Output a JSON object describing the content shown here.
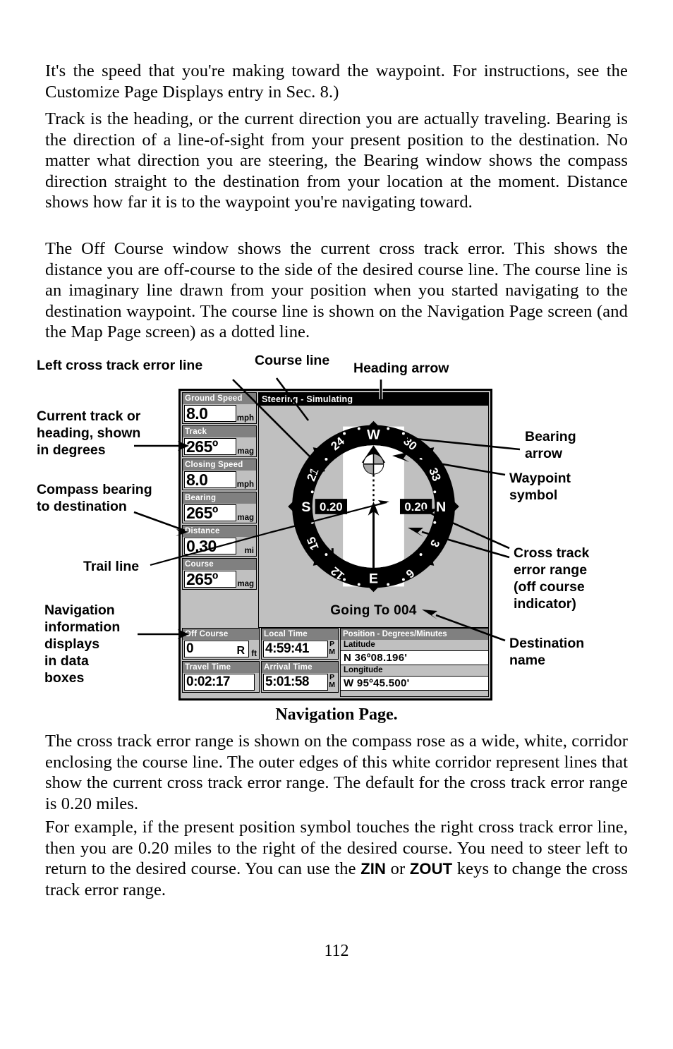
{
  "body_text": {
    "p1": "It's the speed that you're making toward the waypoint. For instructions, see the Customize Page Displays entry in Sec. 8.)",
    "p2": "Track is the heading, or the current direction you are actually traveling. Bearing is the direction of a line-of-sight from your present position to the destination. No matter what direction you are steering, the Bearing window shows the compass direction straight to the destination from your location at the moment. Distance shows how far it is to the waypoint you're navigating toward.",
    "p3": "The Off Course window shows the current cross track error. This shows the distance you are off-course to the side of the desired course line. The course line is an imaginary line drawn from your position when you started navigating to the destination waypoint. The course line is shown on the Navigation Page screen (and the Map Page screen) as a dotted line.",
    "p4": "The cross track error range is shown on the compass rose as a wide, white, corridor enclosing the course line. The outer edges of this white corridor represent lines that show the current cross track error range. The default for the cross track error range is 0.20 miles.",
    "p5_a": "For example, if the present position symbol touches the right cross track error line, then you are 0.20 miles to the right of the desired course. You need to steer left to return to the desired course. You can use the ",
    "p5_key1": "ZIN",
    "p5_b": " or ",
    "p5_key2": "ZOUT",
    "p5_c": " keys to change the cross track error range."
  },
  "figure": {
    "caption": "Navigation Page.",
    "annotations": {
      "left_cross_track_error_line": "Left cross track error line",
      "course_line": "Course line",
      "heading_arrow": "Heading arrow",
      "current_track": "Current track or\nheading, shown\nin degrees",
      "compass_bearing": "Compass bearing\nto destination",
      "trail_line": "Trail line",
      "nav_info_displays": "Navigation\ninformation\ndisplays\nin data\nboxes",
      "bearing_arrow": "Bearing\narrow",
      "waypoint_symbol": "Waypoint\nsymbol",
      "cross_track_error_range": "Cross track\nerror range\n(off course\nindicator)",
      "destination_name": "Destination\nname"
    }
  },
  "gps": {
    "status_bar": "Steering - Simulating",
    "going_to": "Going To 004",
    "left_boxes": [
      {
        "label": "Ground Speed",
        "value": "8.0",
        "unit": "mph"
      },
      {
        "label": "Track",
        "value": "265º",
        "unit": "mag"
      },
      {
        "label": "Closing Speed",
        "value": "8.0",
        "unit": "mph"
      },
      {
        "label": "Bearing",
        "value": "265º",
        "unit": "mag"
      },
      {
        "label": "Distance",
        "value": "0.30",
        "unit": "mi"
      },
      {
        "label": "Course",
        "value": "265º",
        "unit": "mag"
      }
    ],
    "bottom_boxes": [
      {
        "label": "Off Course",
        "value": "0",
        "side": "R",
        "unit": "ft"
      },
      {
        "label": "Travel Time",
        "value": "0:02:17",
        "unit": ""
      },
      {
        "label": "Local Time",
        "value": "4:59:41",
        "ampm": "P\nM"
      },
      {
        "label": "Arrival Time",
        "value": "5:01:58",
        "ampm": "P\nM"
      }
    ],
    "position": {
      "header": "Position - Degrees/Minutes",
      "lat_label": "Latitude",
      "lat_value": "N   36º08.196'",
      "lon_label": "Longitude",
      "lon_value": "W   95º45.500'"
    },
    "compass": {
      "cardinals": {
        "top": "W",
        "right": "N",
        "bottom": "E",
        "left": "S"
      },
      "ticks": [
        "24",
        "30",
        "33",
        "3",
        "6",
        "12",
        "15",
        "21"
      ],
      "xte_left": "0.20",
      "xte_right": "0.20"
    },
    "colors": {
      "screen_bg": "#c0c0c0",
      "header_gray": "#808080",
      "field_white": "#ffffff",
      "ink_black": "#000000"
    }
  },
  "page_number": "112"
}
